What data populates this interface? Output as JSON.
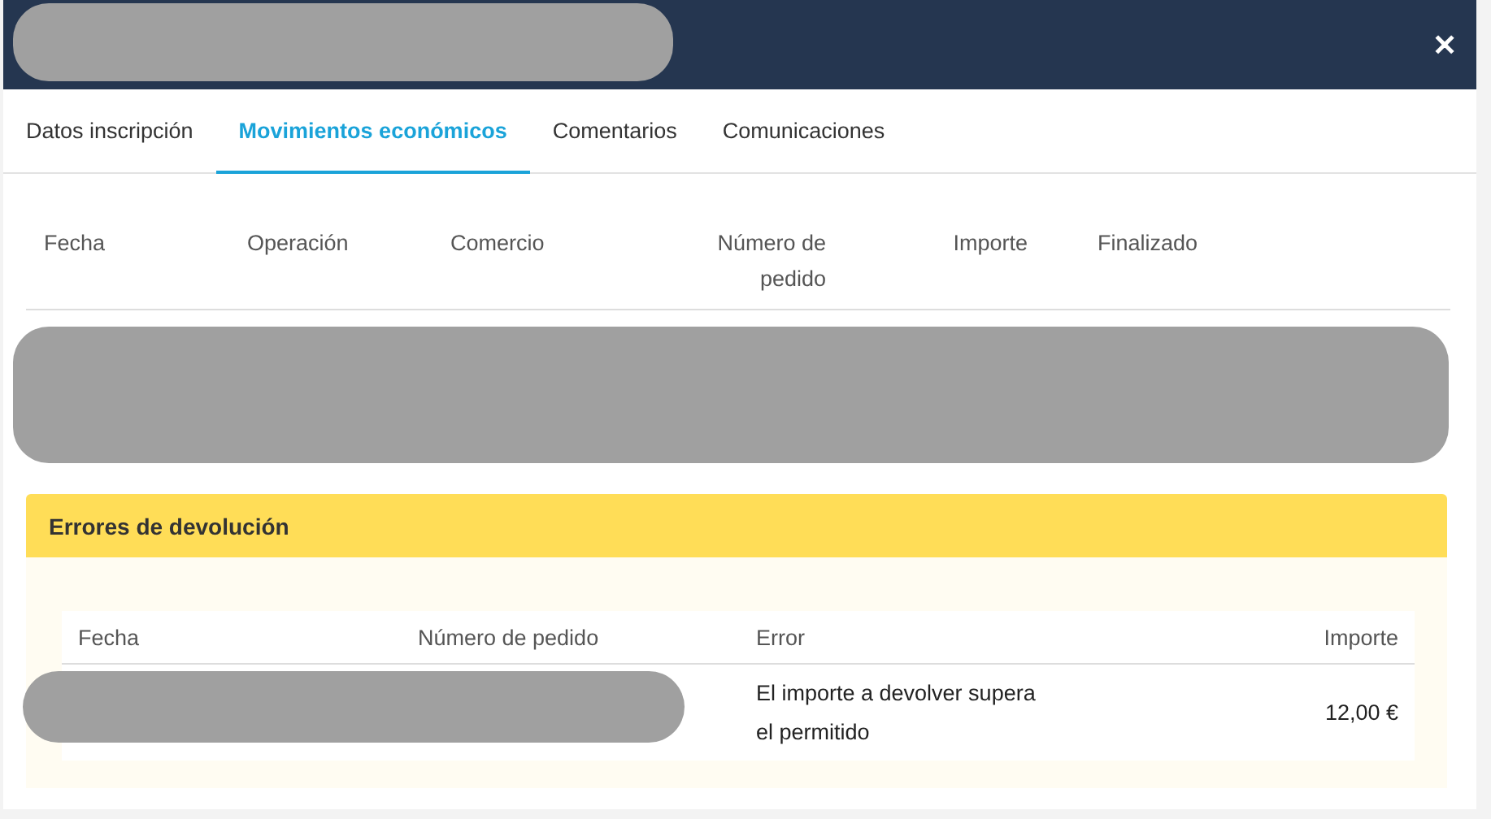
{
  "dialog": {
    "close": "✕"
  },
  "tabs": [
    {
      "label": "Datos inscripción",
      "selected": false
    },
    {
      "label": "Movimientos económicos",
      "selected": true
    },
    {
      "label": "Comentarios",
      "selected": false
    },
    {
      "label": "Comunicaciones",
      "selected": false
    }
  ],
  "movements_table": {
    "columns": [
      "Fecha",
      "Operación",
      "Comercio",
      "Número de pedido",
      "Importe",
      "Finalizado"
    ]
  },
  "return_errors": {
    "title": "Errores de devolución",
    "columns": [
      "Fecha",
      "Número de pedido",
      "Error",
      "Importe"
    ],
    "rows": [
      {
        "error": "El importe a devolver supera el permitido",
        "amount": "12,00 €"
      }
    ]
  }
}
